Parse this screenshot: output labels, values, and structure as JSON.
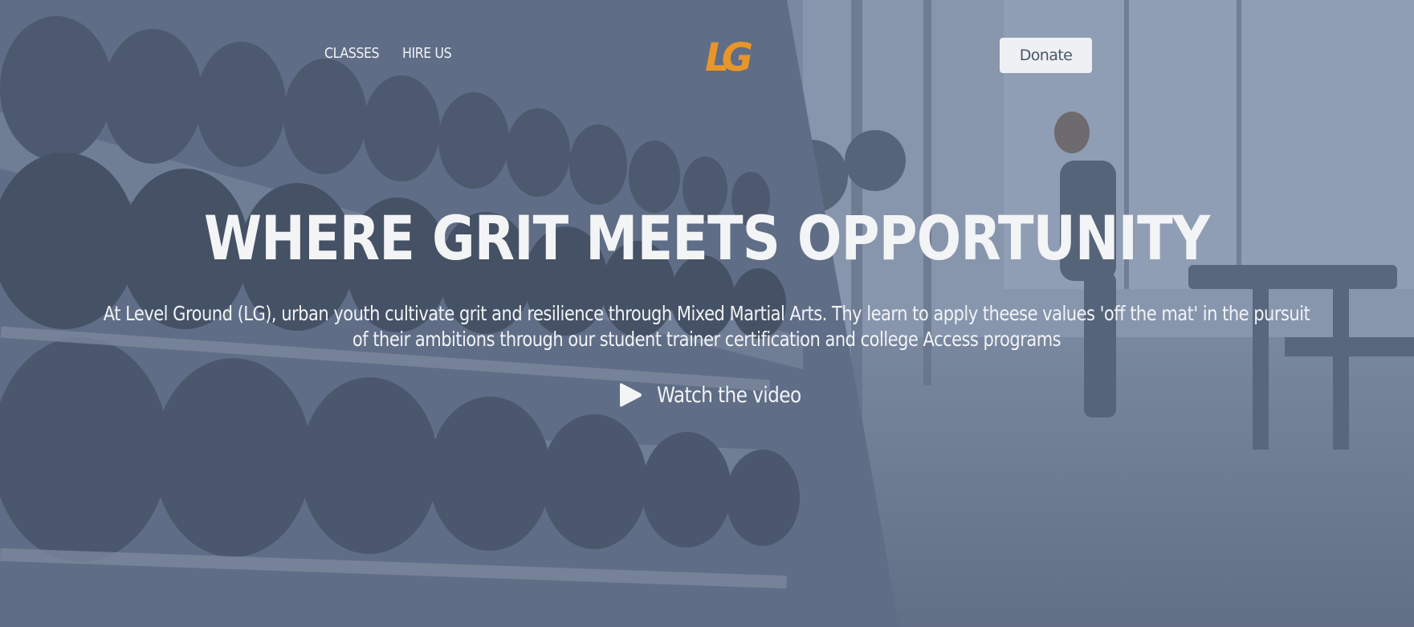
{
  "nav": {
    "links": [
      {
        "label": "CLASSES"
      },
      {
        "label": "HIRE US"
      }
    ],
    "logo": {
      "text": "LG",
      "color": "#e8962a"
    },
    "donate_label": "Donate"
  },
  "hero": {
    "headline": "WHERE GRIT MEETS OPPORTUNITY",
    "subtext": "At Level Ground (LG), urban youth cultivate grit and resilience through Mixed Martial Arts. Thy learn to apply theese values 'off the mat' in the pursuit of their ambitions through our student trainer certification and college Access programs",
    "video_label": "Watch the video",
    "video_icon": "play-icon"
  },
  "colors": {
    "accent": "#e8962a",
    "text": "#f3f4f6",
    "button_bg": "#eef0f3",
    "button_text": "#4a5568"
  }
}
